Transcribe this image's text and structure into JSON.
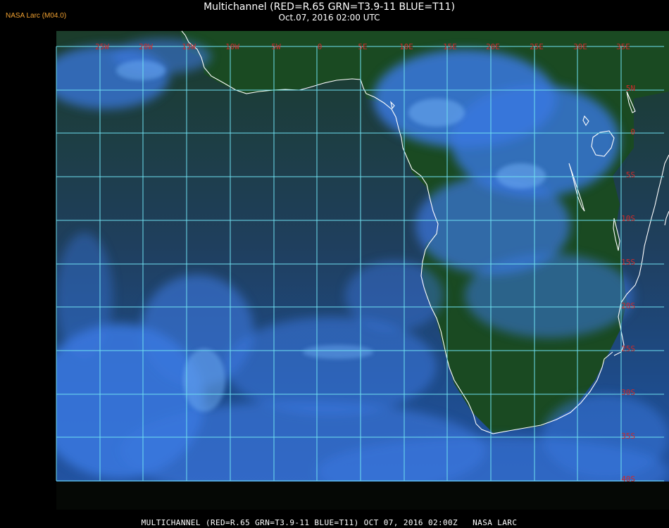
{
  "header": {
    "title": "Multichannel (RED=R.65 GRN=T3.9-11 BLUE=T11)",
    "subtitle": "Oct.07, 2016 02:00 UTC",
    "logo": "NASA Larc (M04.0)"
  },
  "footer": {
    "caption": "MULTICHANNEL (RED=R.65 GRN=T3.9-11 BLUE=T11) OCT 07, 2016 02:00Z   NASA LARC"
  },
  "map": {
    "lon_labels": [
      "25W",
      "20W",
      "15W",
      "10W",
      "5W",
      "0",
      "5E",
      "10E",
      "15E",
      "20E",
      "25E",
      "30E",
      "35E"
    ],
    "lat_labels": [
      "5N",
      "0",
      "5S",
      "10S",
      "15S",
      "20S",
      "25S",
      "30S",
      "35S",
      "40S"
    ],
    "colors": {
      "ocean": "#1a3a68",
      "land": "#14451e",
      "cloud": "#3a78e0",
      "grid": "#6fe0f0",
      "coast": "#ffffff",
      "label": "#cc2a2a"
    }
  }
}
